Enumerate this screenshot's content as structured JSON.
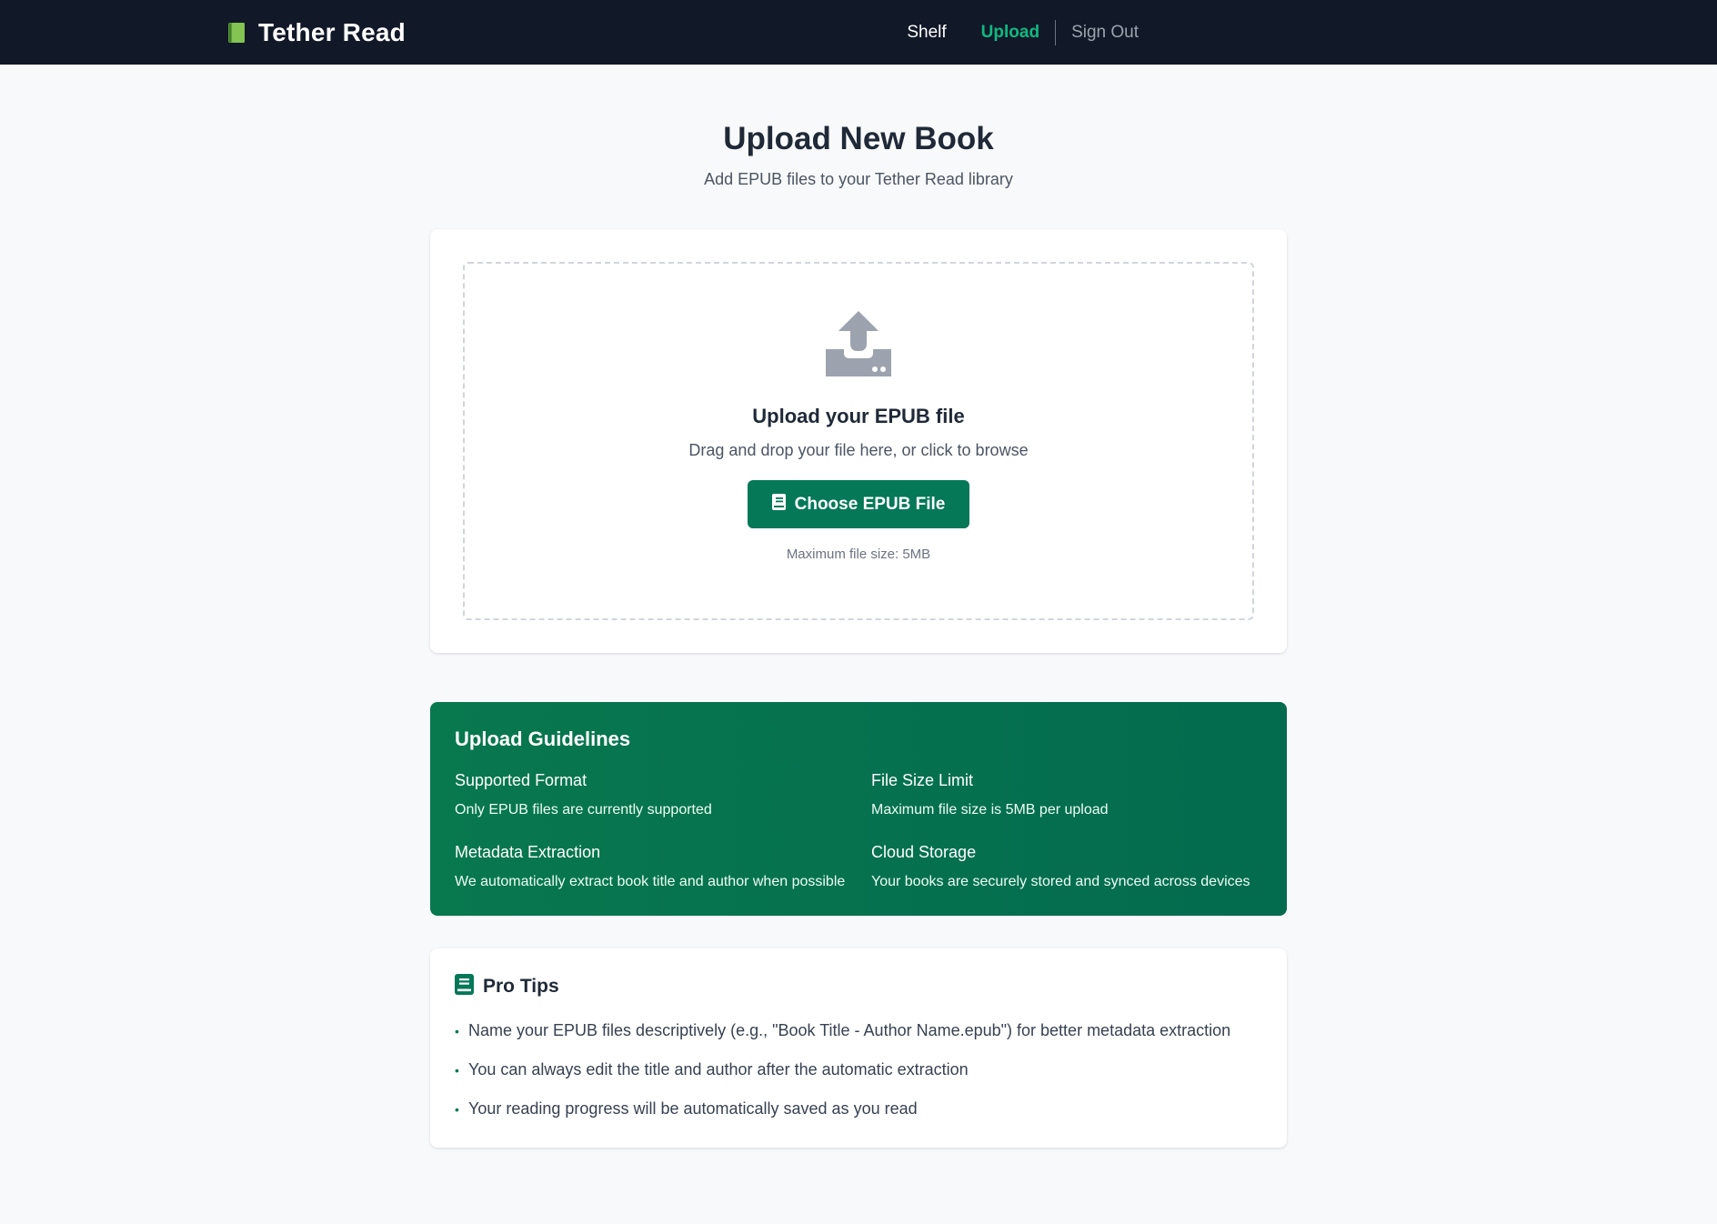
{
  "header": {
    "app_name": "Tether Read",
    "nav": {
      "shelf": "Shelf",
      "upload": "Upload",
      "sign_out": "Sign Out"
    }
  },
  "page": {
    "title": "Upload New Book",
    "subtitle": "Add EPUB files to your Tether Read library"
  },
  "dropzone": {
    "icon": "upload-tray-icon",
    "title": "Upload your EPUB file",
    "subtitle": "Drag and drop your file here, or click to browse",
    "button_label": "Choose EPUB File",
    "limit_note": "Maximum file size: 5MB"
  },
  "guidelines": {
    "title": "Upload Guidelines",
    "items": [
      {
        "title": "Supported Format",
        "desc": "Only EPUB files are currently supported"
      },
      {
        "title": "File Size Limit",
        "desc": "Maximum file size is 5MB per upload"
      },
      {
        "title": "Metadata Extraction",
        "desc": "We automatically extract book title and author when possible"
      },
      {
        "title": "Cloud Storage",
        "desc": "Your books are securely stored and synced across devices"
      }
    ]
  },
  "tips": {
    "title": "Pro Tips",
    "items": [
      "Name your EPUB files descriptively (e.g., \"Book Title - Author Name.epub\") for better metadata extraction",
      "You can always edit the title and author after the automatic extraction",
      "Your reading progress will be automatically saved as you read"
    ]
  },
  "colors": {
    "topbar": "#111827",
    "accent": "#047857",
    "nav_active": "#10b981",
    "page_bg": "#f8f9fa"
  }
}
